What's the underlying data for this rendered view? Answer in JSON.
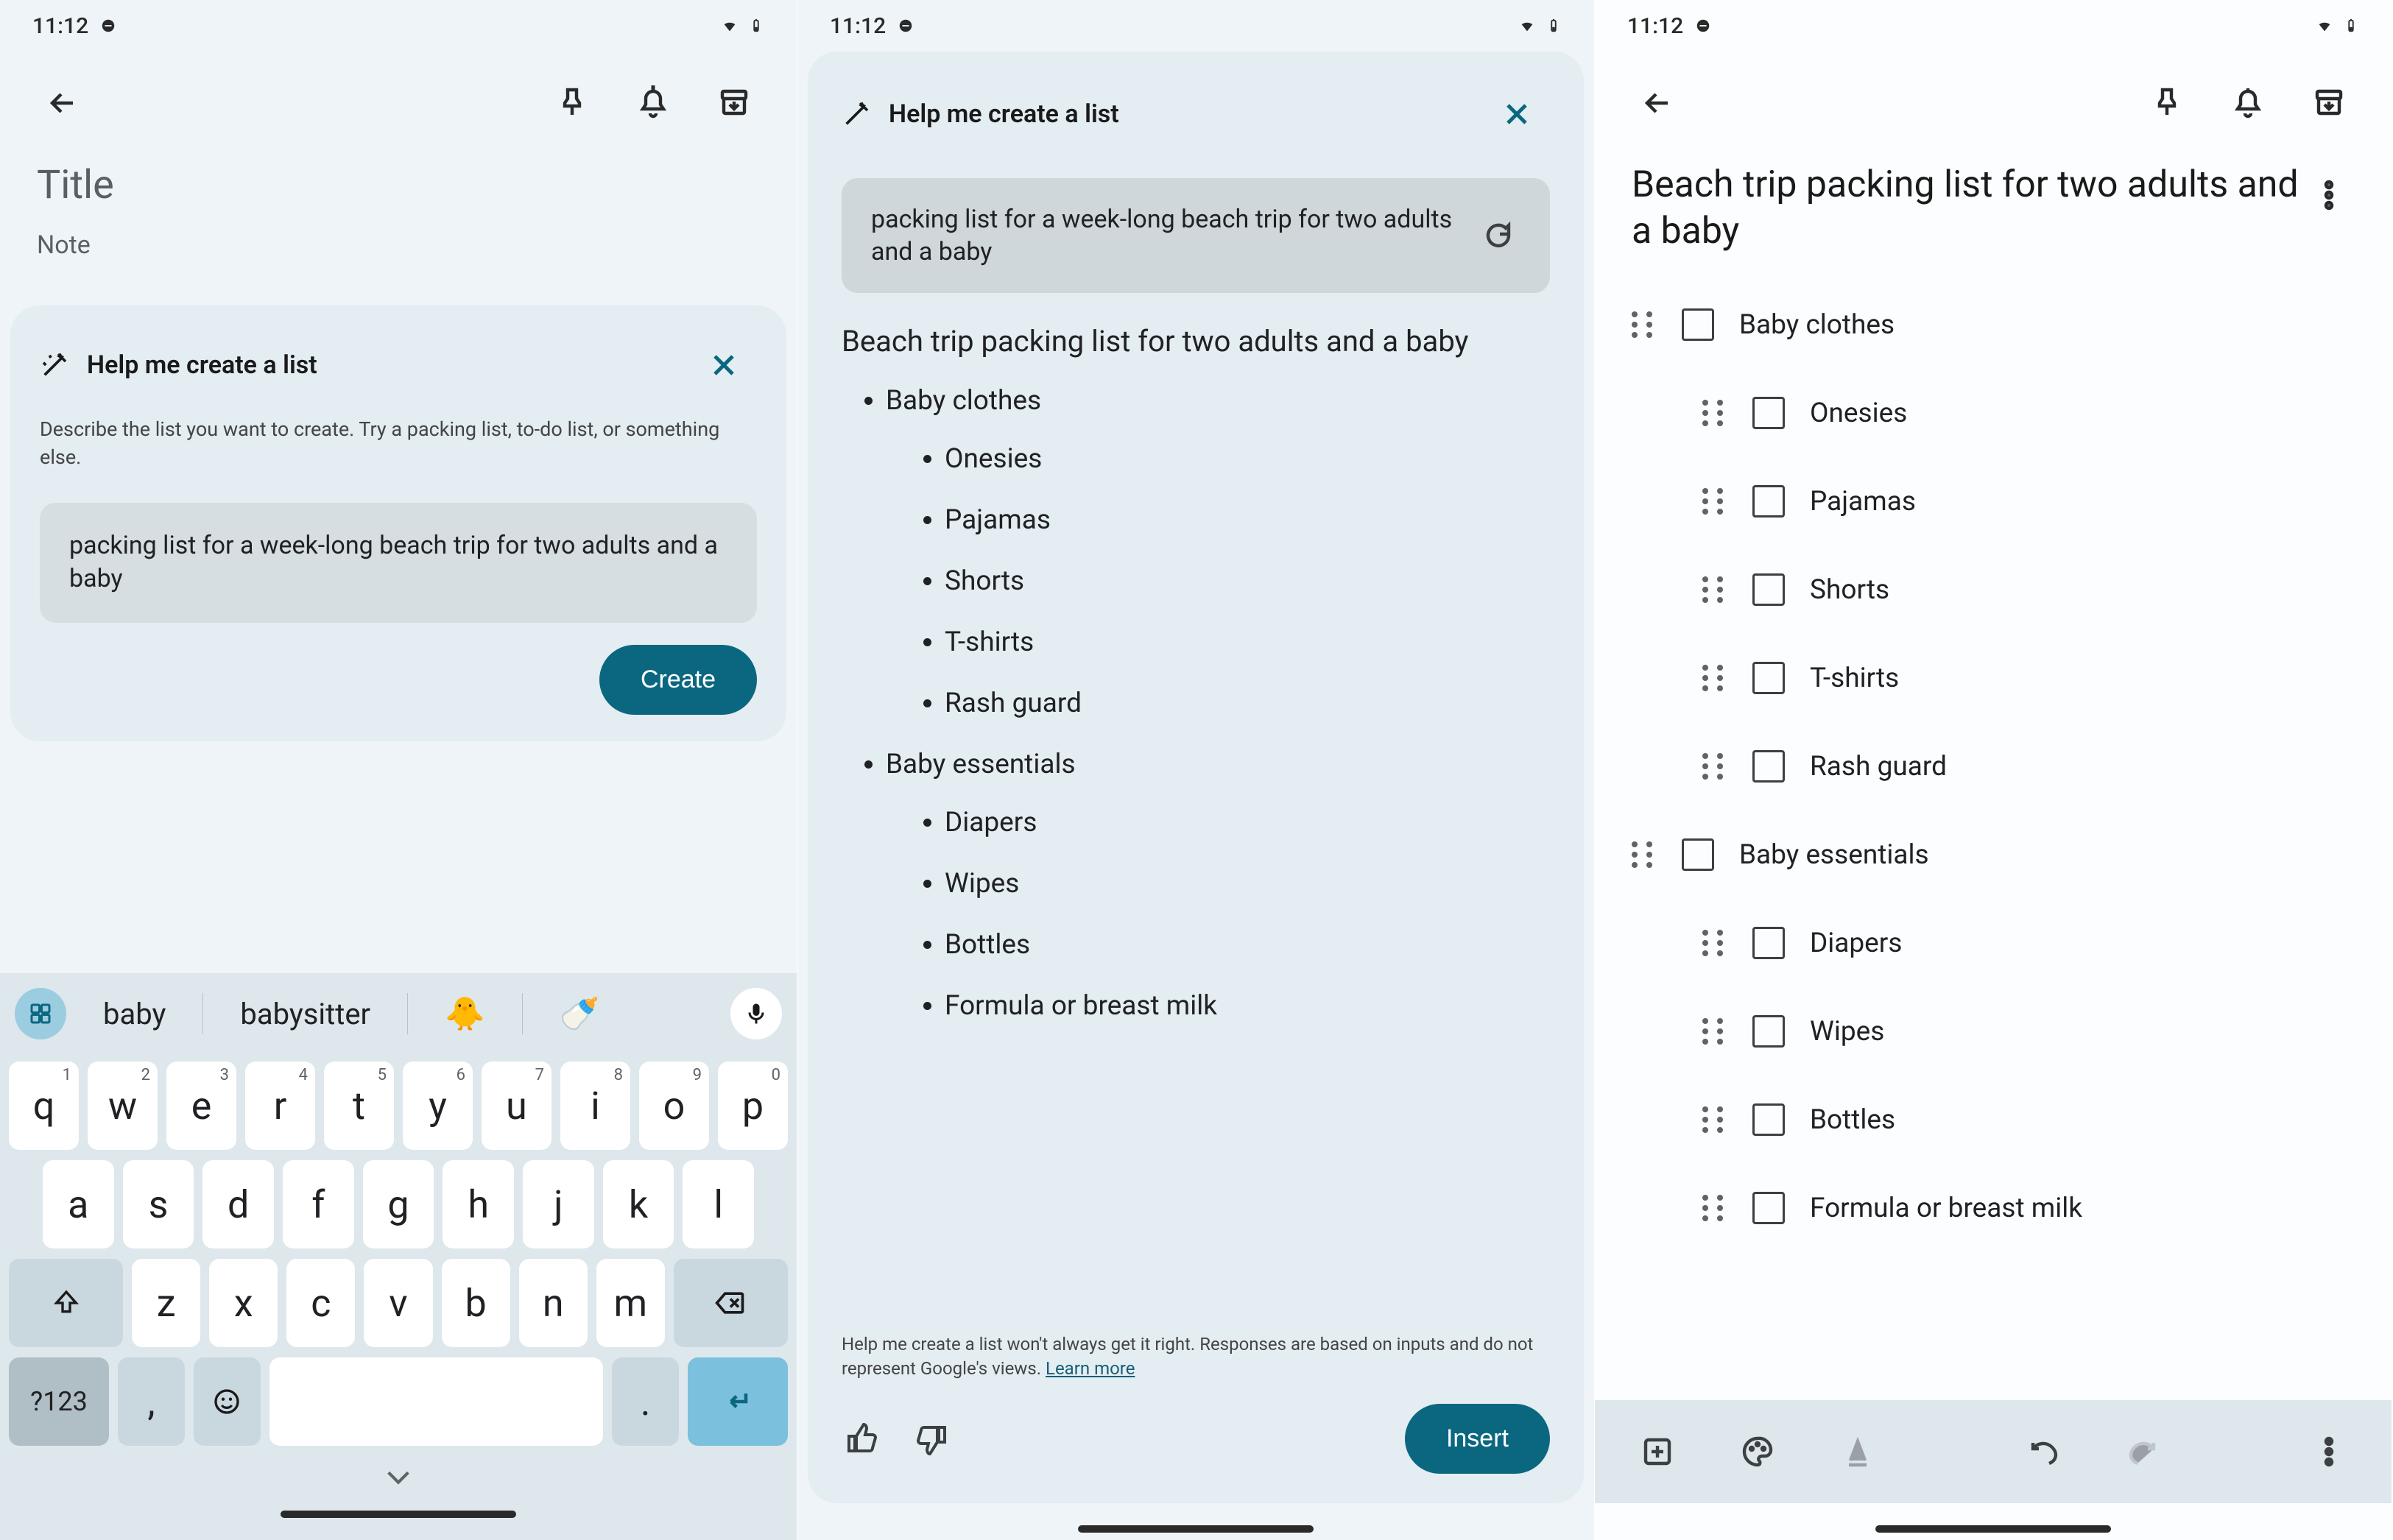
{
  "status": {
    "time": "11:12"
  },
  "screen1": {
    "title_placeholder": "Title",
    "note_placeholder": "Note",
    "ai": {
      "heading": "Help me create a list",
      "description": "Describe the list you want to create. Try a packing list, to-do list, or something else.",
      "input_text": "packing list for a week-long beach trip for two adults and a baby",
      "create_label": "Create"
    },
    "keyboard": {
      "suggestions": [
        "baby",
        "babysitter"
      ],
      "row1": [
        {
          "k": "q",
          "n": "1"
        },
        {
          "k": "w",
          "n": "2"
        },
        {
          "k": "e",
          "n": "3"
        },
        {
          "k": "r",
          "n": "4"
        },
        {
          "k": "t",
          "n": "5"
        },
        {
          "k": "y",
          "n": "6"
        },
        {
          "k": "u",
          "n": "7"
        },
        {
          "k": "i",
          "n": "8"
        },
        {
          "k": "o",
          "n": "9"
        },
        {
          "k": "p",
          "n": "0"
        }
      ],
      "row2": [
        "a",
        "s",
        "d",
        "f",
        "g",
        "h",
        "j",
        "k",
        "l"
      ],
      "row3": [
        "z",
        "x",
        "c",
        "v",
        "b",
        "n",
        "m"
      ],
      "sym_label": "?123",
      "comma": ",",
      "period": "."
    }
  },
  "screen2": {
    "ai_heading": "Help me create a list",
    "prompt": "packing list for a week-long beach trip for two adults and a baby",
    "result_title": "Beach trip packing list for two adults and a baby",
    "list": [
      {
        "text": "Baby clothes",
        "children": [
          "Onesies",
          "Pajamas",
          "Shorts",
          "T-shirts",
          "Rash guard"
        ]
      },
      {
        "text": "Baby essentials",
        "children": [
          "Diapers",
          "Wipes",
          "Bottles",
          "Formula or breast milk"
        ]
      }
    ],
    "disclaimer": "Help me create a list won't always get it right. Responses are based on inputs and do not represent Google's views. ",
    "learn_more": "Learn more",
    "insert_label": "Insert"
  },
  "screen3": {
    "title": "Beach trip packing list for two adults and a baby",
    "items": [
      {
        "label": "Baby clothes",
        "indent": false
      },
      {
        "label": "Onesies",
        "indent": true
      },
      {
        "label": "Pajamas",
        "indent": true
      },
      {
        "label": "Shorts",
        "indent": true
      },
      {
        "label": "T-shirts",
        "indent": true
      },
      {
        "label": "Rash guard",
        "indent": true
      },
      {
        "label": "Baby essentials",
        "indent": false
      },
      {
        "label": "Diapers",
        "indent": true
      },
      {
        "label": "Wipes",
        "indent": true
      },
      {
        "label": "Bottles",
        "indent": true
      },
      {
        "label": "Formula or breast milk",
        "indent": true
      }
    ]
  }
}
